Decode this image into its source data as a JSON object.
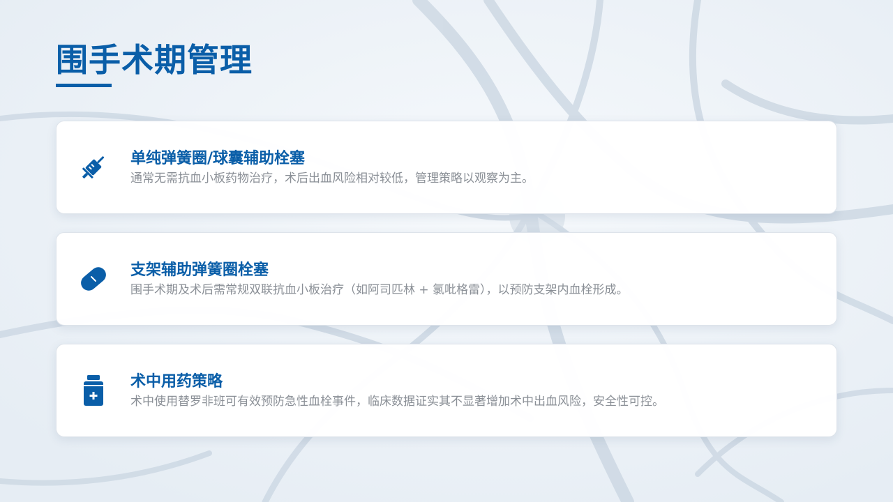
{
  "page": {
    "title": "围手术期管理"
  },
  "colors": {
    "accent": "#0a5ea8",
    "text_muted": "#8a8f96",
    "card_bg": "#ffffff",
    "background": "#eef3f8"
  },
  "cards": [
    {
      "icon": "syringe-icon",
      "title": "单纯弹簧圈/球囊辅助栓塞",
      "description": "通常无需抗血小板药物治疗，术后出血风险相对较低，管理策略以观察为主。"
    },
    {
      "icon": "pill-capsule-icon",
      "title": "支架辅助弹簧圈栓塞",
      "description": "围手术期及术后需常规双联抗血小板治疗（如阿司匹林 + 氯吡格雷），以预防支架内血栓形成。"
    },
    {
      "icon": "medicine-bottle-icon",
      "title": "术中用药策略",
      "description": "术中使用替罗非班可有效预防急性血栓事件，临床数据证实其不显著增加术中出血风险，安全性可控。"
    }
  ]
}
